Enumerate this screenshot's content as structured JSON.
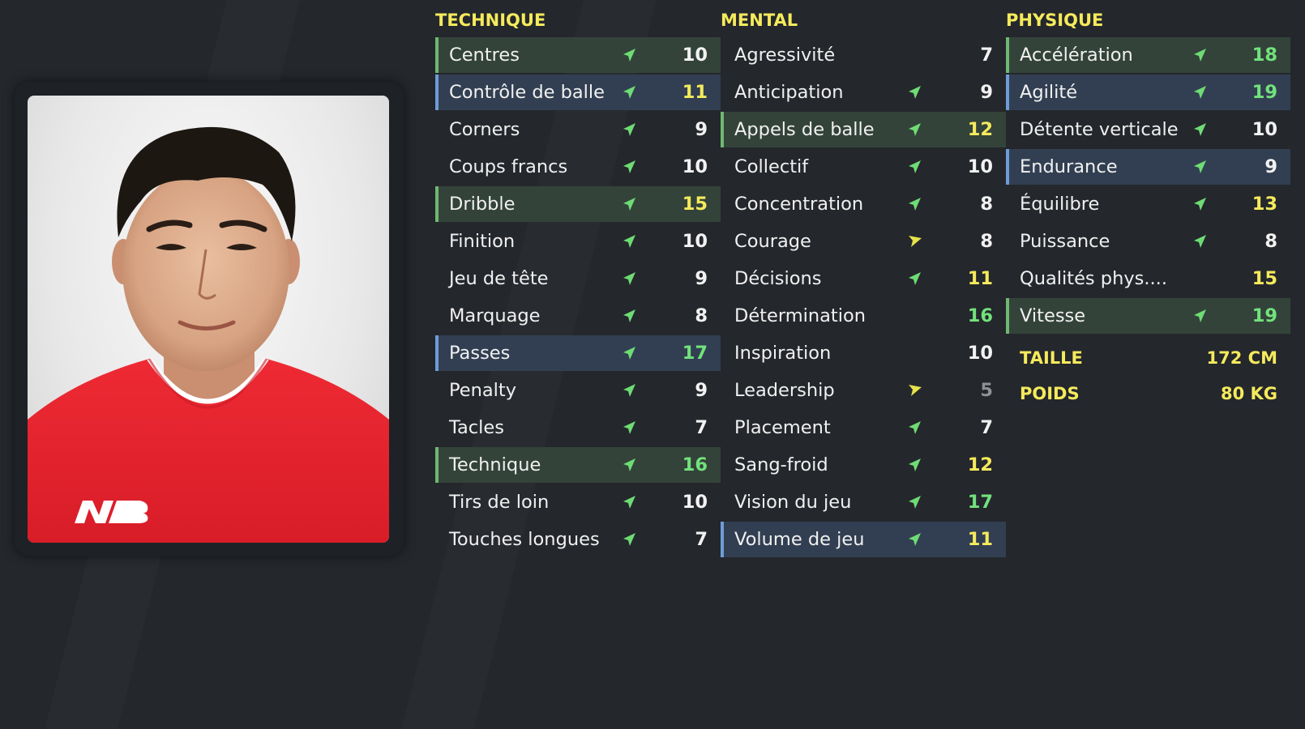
{
  "colors": {
    "background": "#24272c",
    "heading_yellow": "#f5ea5c",
    "value_green": "#72e27c",
    "value_grey": "#8e9196",
    "row_green_bg": "#33433a",
    "row_blue_bg": "#323f52",
    "arrow_up": "#6edc74",
    "arrow_side": "#e6e24a"
  },
  "technique": {
    "title": "TECHNIQUE",
    "rows": [
      {
        "label": "Centres",
        "value": "10",
        "arrow": "up",
        "highlight": "green",
        "tone": "white"
      },
      {
        "label": "Contrôle de balle",
        "value": "11",
        "arrow": "up",
        "highlight": "blue",
        "tone": "yellow"
      },
      {
        "label": "Corners",
        "value": "9",
        "arrow": "up",
        "highlight": "",
        "tone": "white"
      },
      {
        "label": "Coups francs",
        "value": "10",
        "arrow": "up",
        "highlight": "",
        "tone": "white"
      },
      {
        "label": "Dribble",
        "value": "15",
        "arrow": "up",
        "highlight": "green",
        "tone": "yellow"
      },
      {
        "label": "Finition",
        "value": "10",
        "arrow": "up",
        "highlight": "",
        "tone": "white"
      },
      {
        "label": "Jeu de tête",
        "value": "9",
        "arrow": "up",
        "highlight": "",
        "tone": "white"
      },
      {
        "label": "Marquage",
        "value": "8",
        "arrow": "up",
        "highlight": "",
        "tone": "white"
      },
      {
        "label": "Passes",
        "value": "17",
        "arrow": "up",
        "highlight": "blue",
        "tone": "green"
      },
      {
        "label": "Penalty",
        "value": "9",
        "arrow": "up",
        "highlight": "",
        "tone": "white"
      },
      {
        "label": "Tacles",
        "value": "7",
        "arrow": "up",
        "highlight": "",
        "tone": "white"
      },
      {
        "label": "Technique",
        "value": "16",
        "arrow": "up",
        "highlight": "green",
        "tone": "green"
      },
      {
        "label": "Tirs de loin",
        "value": "10",
        "arrow": "up",
        "highlight": "",
        "tone": "white"
      },
      {
        "label": "Touches longues",
        "value": "7",
        "arrow": "up",
        "highlight": "",
        "tone": "white"
      }
    ]
  },
  "mental": {
    "title": "MENTAL",
    "rows": [
      {
        "label": "Agressivité",
        "value": "7",
        "arrow": "",
        "highlight": "",
        "tone": "white"
      },
      {
        "label": "Anticipation",
        "value": "9",
        "arrow": "up",
        "highlight": "",
        "tone": "white"
      },
      {
        "label": "Appels de balle",
        "value": "12",
        "arrow": "up",
        "highlight": "green",
        "tone": "yellow"
      },
      {
        "label": "Collectif",
        "value": "10",
        "arrow": "up",
        "highlight": "",
        "tone": "white"
      },
      {
        "label": "Concentration",
        "value": "8",
        "arrow": "up",
        "highlight": "",
        "tone": "white"
      },
      {
        "label": "Courage",
        "value": "8",
        "arrow": "side",
        "highlight": "",
        "tone": "white"
      },
      {
        "label": "Décisions",
        "value": "11",
        "arrow": "up",
        "highlight": "",
        "tone": "yellow"
      },
      {
        "label": "Détermination",
        "value": "16",
        "arrow": "",
        "highlight": "",
        "tone": "green"
      },
      {
        "label": "Inspiration",
        "value": "10",
        "arrow": "",
        "highlight": "",
        "tone": "white"
      },
      {
        "label": "Leadership",
        "value": "5",
        "arrow": "side",
        "highlight": "",
        "tone": "grey"
      },
      {
        "label": "Placement",
        "value": "7",
        "arrow": "up",
        "highlight": "",
        "tone": "white"
      },
      {
        "label": "Sang-froid",
        "value": "12",
        "arrow": "up",
        "highlight": "",
        "tone": "yellow"
      },
      {
        "label": "Vision du jeu",
        "value": "17",
        "arrow": "up",
        "highlight": "",
        "tone": "green"
      },
      {
        "label": "Volume de jeu",
        "value": "11",
        "arrow": "up",
        "highlight": "blue",
        "tone": "yellow"
      }
    ]
  },
  "physique": {
    "title": "PHYSIQUE",
    "rows": [
      {
        "label": "Accélération",
        "value": "18",
        "arrow": "up",
        "highlight": "green",
        "tone": "green"
      },
      {
        "label": "Agilité",
        "value": "19",
        "arrow": "up",
        "highlight": "blue",
        "tone": "green"
      },
      {
        "label": "Détente verticale",
        "value": "10",
        "arrow": "up",
        "highlight": "",
        "tone": "white"
      },
      {
        "label": "Endurance",
        "value": "9",
        "arrow": "up",
        "highlight": "blue",
        "tone": "white"
      },
      {
        "label": "Équilibre",
        "value": "13",
        "arrow": "up",
        "highlight": "",
        "tone": "yellow"
      },
      {
        "label": "Puissance",
        "value": "8",
        "arrow": "up",
        "highlight": "",
        "tone": "white"
      },
      {
        "label": "Qualités phys....",
        "value": "15",
        "arrow": "",
        "highlight": "",
        "tone": "yellow"
      },
      {
        "label": "Vitesse",
        "value": "19",
        "arrow": "up",
        "highlight": "green",
        "tone": "green"
      }
    ],
    "info": [
      {
        "label": "TAILLE",
        "value": "172 CM"
      },
      {
        "label": "POIDS",
        "value": "80 KG"
      }
    ]
  },
  "photo": {
    "shirt_color": "#e8232e",
    "shirt_logo": "NB"
  }
}
